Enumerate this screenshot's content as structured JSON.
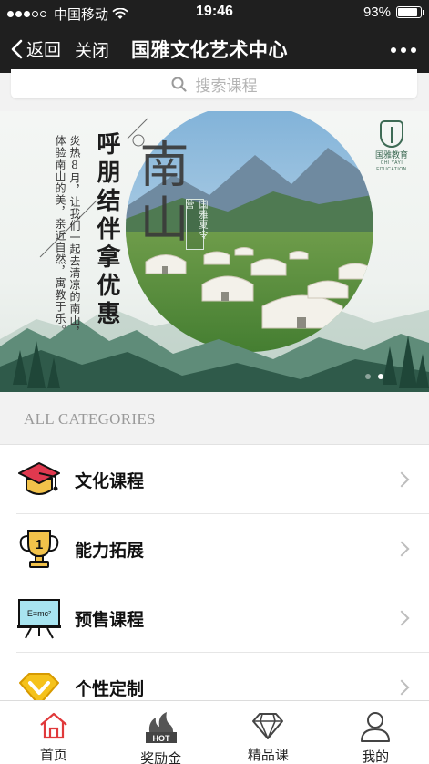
{
  "status_bar": {
    "carrier": "中国移动",
    "time": "19:46",
    "battery_text": "93%",
    "battery_level": 0.93
  },
  "nav": {
    "back_label": "返回",
    "close_label": "关闭",
    "title": "国雅文化艺术中心"
  },
  "search": {
    "placeholder": "搜索课程"
  },
  "banner": {
    "slogan": "呼朋结伴拿优惠",
    "description": "炎热8月，让我们一起去清凉的南山，体验南山的美，亲近自然，寓教于乐。",
    "headline": "南山",
    "camp_tag": "国雅夏令营",
    "logo_name": "国雅教育",
    "logo_sub": "CHI YAYI EDUCATION",
    "slide_count": 2,
    "active_slide": 2
  },
  "categories": {
    "header": "ALL CATEGORIES",
    "items": [
      {
        "label": "文化课程",
        "icon": "graduation-cap-icon"
      },
      {
        "label": "能力拓展",
        "icon": "trophy-icon"
      },
      {
        "label": "预售课程",
        "icon": "easel-icon"
      },
      {
        "label": "个性定制",
        "icon": "crown-icon"
      }
    ]
  },
  "easel_text": "E=mc²",
  "hot_badge": "HOT",
  "trophy_number": "1",
  "tabs": [
    {
      "label": "首页",
      "icon": "home-icon",
      "active": true
    },
    {
      "label": "奖励金",
      "icon": "hot-flame-icon",
      "active": false
    },
    {
      "label": "精品课",
      "icon": "diamond-icon",
      "active": false
    },
    {
      "label": "我的",
      "icon": "user-icon",
      "active": false
    }
  ],
  "colors": {
    "nav_bg": "#1f1f1f",
    "active_tab": "#e0393b",
    "accent_green": "#3e6b55"
  }
}
